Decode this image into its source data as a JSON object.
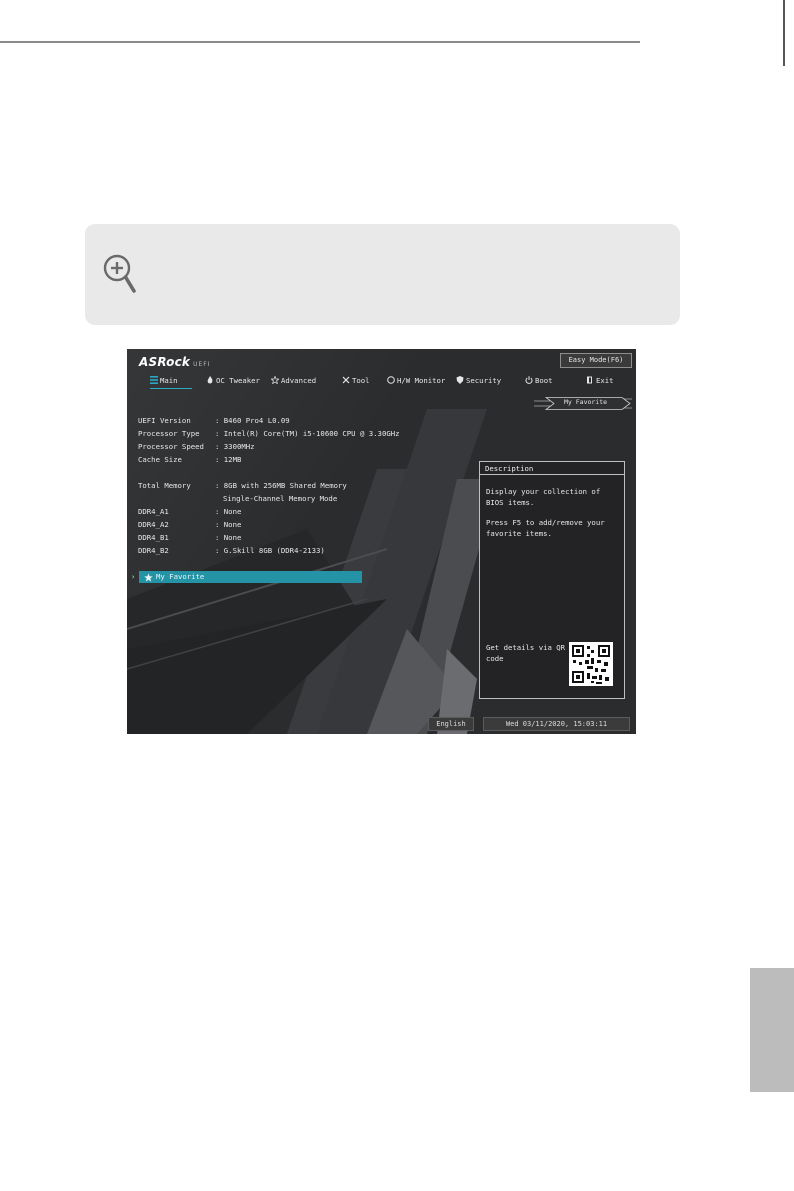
{
  "bios": {
    "logo": "ASRock",
    "logo_sub": "UEFI",
    "easy_mode": "Easy Mode(F6)",
    "nav": [
      {
        "label": "Main",
        "icon": "list-icon"
      },
      {
        "label": "OC Tweaker",
        "icon": "flame-icon"
      },
      {
        "label": "Advanced",
        "icon": "star-outline-icon"
      },
      {
        "label": "Tool",
        "icon": "tools-icon"
      },
      {
        "label": "H/W Monitor",
        "icon": "monitor-icon"
      },
      {
        "label": "Security",
        "icon": "shield-icon"
      },
      {
        "label": "Boot",
        "icon": "power-icon"
      },
      {
        "label": "Exit",
        "icon": "exit-icon"
      }
    ],
    "favorite_tag": "My Favorite",
    "info": [
      {
        "label": "UEFI Version",
        "value": ": B460 Pro4 L0.09"
      },
      {
        "label": "Processor Type",
        "value": ": Intel(R) Core(TM) i5-10600 CPU @ 3.30GHz"
      },
      {
        "label": "Processor Speed",
        "value": ": 3300MHz"
      },
      {
        "label": "Cache Size",
        "value": ": 12MB"
      },
      {
        "label": "Total Memory",
        "value": ": 8GB with 256MB Shared Memory"
      },
      {
        "label": "",
        "value": "Single-Channel Memory Mode"
      },
      {
        "label": "DDR4_A1",
        "value": ": None"
      },
      {
        "label": "DDR4_A2",
        "value": ": None"
      },
      {
        "label": "DDR4_B1",
        "value": ": None"
      },
      {
        "label": "DDR4_B2",
        "value": ": G.Skill 8GB (DDR4-2133)"
      }
    ],
    "favorite_item": "My Favorite",
    "description": {
      "title": "Description",
      "line1": "Display your collection of BIOS items.",
      "line2": "Press F5 to add/remove your favorite items.",
      "qr_text": "Get details via QR code"
    },
    "status": {
      "language": "English",
      "datetime": "Wed 03/11/2020, 15:03:11"
    }
  }
}
